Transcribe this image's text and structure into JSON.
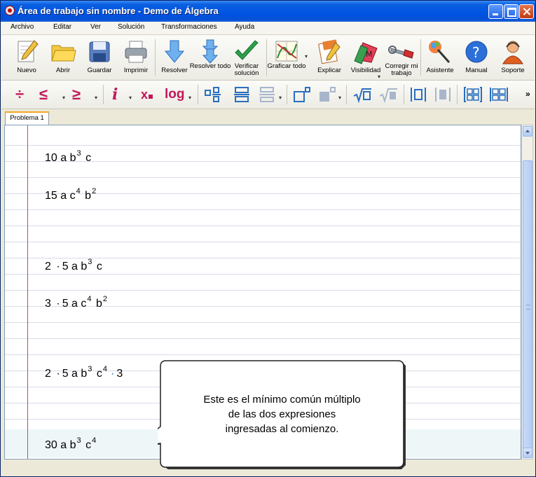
{
  "window": {
    "title": "Área de trabajo sin nombre - Demo de Álgebra"
  },
  "menu": [
    "Archivo",
    "Editar",
    "Ver",
    "Solución",
    "Transformaciones",
    "Ayuda"
  ],
  "toolbar": {
    "nuevo": "Nuevo",
    "abrir": "Abrir",
    "guardar": "Guardar",
    "imprimir": "Imprimir",
    "resolver": "Resolver",
    "resolver_todo": "Resolver todo",
    "verificar_solucion": "Verificar solución",
    "graficar_todo": "Graficar todo",
    "explicar": "Explicar",
    "visibilidad": "Visibilidad",
    "corregir": "Corregir mi trabajo",
    "asistente": "Asistente",
    "manual": "Manual",
    "soporte": "Soporte"
  },
  "math_toolbar": {
    "divide": "÷",
    "leq": "≤",
    "geq": "≥",
    "italic": "i",
    "subscript": "x",
    "log": "log",
    "more": "»"
  },
  "tab": {
    "label": "Problema 1"
  },
  "expressions": {
    "e1": {
      "a": "10 a b",
      "b_exp": "3",
      "c": "c"
    },
    "e2": {
      "a": "15 a c",
      "c_exp": "4",
      "b": "b",
      "b_exp": "2"
    },
    "e3": {
      "n": "2",
      "dot": "·",
      "rest": "5 a b",
      "b_exp": "3",
      "c": "c"
    },
    "e4": {
      "n": "3",
      "dot": "·",
      "rest": "5 a c",
      "c_exp": "4",
      "b": "b",
      "b_exp": "2"
    },
    "e5": {
      "n": "2",
      "dot": "·",
      "rest": "5 a b",
      "b_exp": "3",
      "c": "c",
      "c_exp": "4",
      "dot2": "·",
      "tail": "3"
    },
    "e6": {
      "a": "30 a b",
      "b_exp": "3",
      "c": "c",
      "c_exp": "4"
    }
  },
  "callout": {
    "line1": "Este es el mínimo común múltiplo",
    "line2": "de las dos expresiones",
    "line3": "ingresadas al comienzo."
  }
}
